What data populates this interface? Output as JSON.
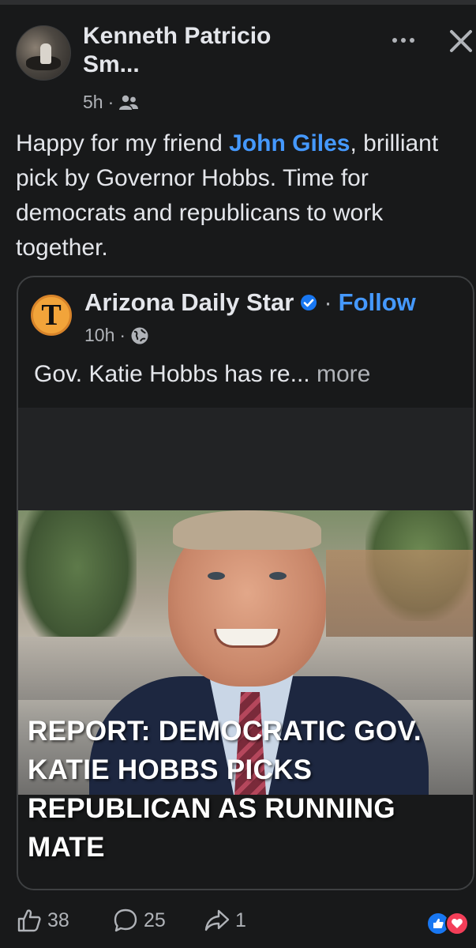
{
  "post": {
    "author": "Kenneth Patricio Sm...",
    "time": "5h",
    "privacy_icon": "friends-icon",
    "text_before": "Happy for my friend ",
    "mention": "John Giles",
    "text_after": ", brilliant pick by Governor Hobbs. Time for democrats and republicans to work together."
  },
  "shared": {
    "page_name": "Arizona Daily Star",
    "logo_letter": "T",
    "follow_label": "Follow",
    "time": "10h",
    "privacy_icon": "globe-icon",
    "preview_text": "Gov. Katie Hobbs has re...",
    "more_label": "more",
    "headline": "REPORT: DEMOCRATIC GOV. KATIE HOBBS PICKS REPUBLICAN AS RUNNING MATE"
  },
  "footer": {
    "likes": "38",
    "comments": "25",
    "shares": "1"
  },
  "colors": {
    "background": "#18191a",
    "link": "#4599ff",
    "muted": "#b0b3b8",
    "like": "#1877f2",
    "love": "#f33e58"
  }
}
